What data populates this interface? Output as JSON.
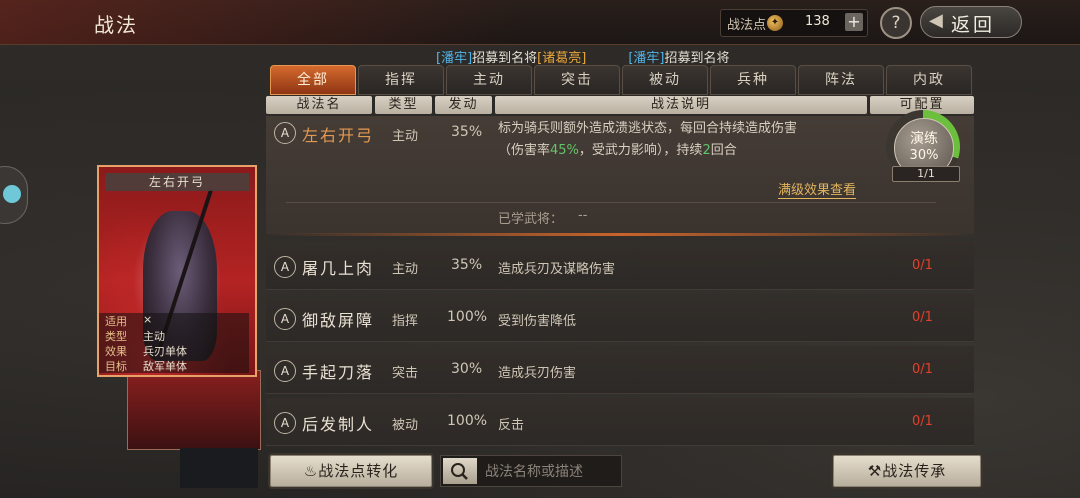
{
  "header": {
    "title": "战法",
    "points_label": "战法点",
    "points_value": "138",
    "plus": "+",
    "help": "?",
    "back_label": "返回"
  },
  "ticker": [
    {
      "text": "[潘牢]",
      "color": "blue"
    },
    {
      "text": "招募到名将",
      "color": "white"
    },
    {
      "text": "[诸葛亮]",
      "color": "gold"
    },
    {
      "text": "[潘牢]",
      "color": "blue"
    },
    {
      "text": "招募到名将",
      "color": "white"
    }
  ],
  "tabs": [
    "全部",
    "指挥",
    "主动",
    "突击",
    "被动",
    "兵种",
    "阵法",
    "内政"
  ],
  "active_tab": "全部",
  "columns": {
    "name": "战法名",
    "type": "类型",
    "rate": "发动",
    "desc": "战法说明",
    "config": "可配置"
  },
  "expanded": {
    "grade": "A",
    "name": "左右开弓",
    "type": "主动",
    "rate": "35%",
    "desc_line1": "标为骑兵则额外造成溃逃状态，每回合持续造成伤害",
    "desc_line2_a": "（伤害率",
    "desc_line2_pct": "45%",
    "desc_line2_b": "，受武力影响），持续",
    "desc_line2_n": "2",
    "desc_line2_c": "回合",
    "view_link": "满级效果查看",
    "learned_label": "已学武将：",
    "learned_value": "--",
    "train_label": "演练",
    "train_pct": "30%",
    "train_progress": 0.3,
    "train_count": "1/1"
  },
  "skills": [
    {
      "grade": "A",
      "name": "屠几上肉",
      "type": "主动",
      "rate": "35%",
      "desc": "造成兵刃及谋略伤害",
      "count": "0/1"
    },
    {
      "grade": "A",
      "name": "御敌屏障",
      "type": "指挥",
      "rate": "100%",
      "desc": "受到伤害降低",
      "count": "0/1"
    },
    {
      "grade": "A",
      "name": "手起刀落",
      "type": "突击",
      "rate": "30%",
      "desc": "造成兵刃伤害",
      "count": "0/1"
    },
    {
      "grade": "A",
      "name": "后发制人",
      "type": "被动",
      "rate": "100%",
      "desc": "反击",
      "count": "0/1"
    }
  ],
  "card": {
    "title": "左右开弓",
    "rows": [
      {
        "key": "适用",
        "value": "⨯"
      },
      {
        "key": "类型",
        "value": "主动"
      },
      {
        "key": "效果",
        "value": "兵刃单体"
      },
      {
        "key": "目标",
        "value": "敌军单体"
      }
    ]
  },
  "bottom": {
    "convert_label": "战法点转化",
    "search_placeholder": "战法名称或描述",
    "inherit_label": "战法传承"
  },
  "colors": {
    "accent": "#d56a2d",
    "warn": "#e0412e",
    "progress": "#6bbf3c",
    "ticker_blue": "#4fb4e8",
    "ticker_gold": "#e8a63a"
  }
}
